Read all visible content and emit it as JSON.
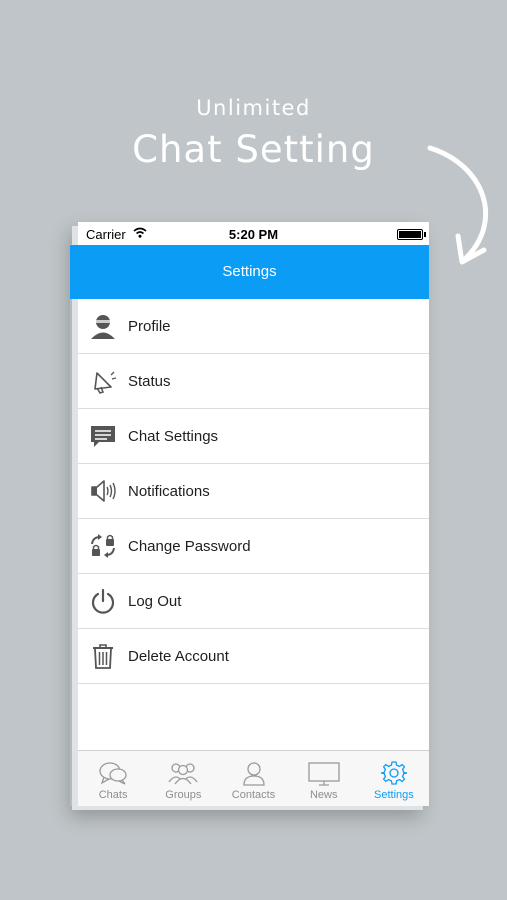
{
  "promo": {
    "subtitle": "Unlimited",
    "title": "Chat Setting"
  },
  "status_bar": {
    "carrier": "Carrier",
    "time": "5:20 PM"
  },
  "nav": {
    "title": "Settings",
    "color": "#0b9df5"
  },
  "menu": [
    {
      "label": "Profile",
      "icon": "profile-icon"
    },
    {
      "label": "Status",
      "icon": "megaphone-icon"
    },
    {
      "label": "Chat Settings",
      "icon": "chat-bubble-icon"
    },
    {
      "label": "Notifications",
      "icon": "speaker-icon"
    },
    {
      "label": "Change Password",
      "icon": "refresh-lock-icon"
    },
    {
      "label": "Log Out",
      "icon": "power-icon"
    },
    {
      "label": "Delete Account",
      "icon": "trash-icon"
    }
  ],
  "tabs": [
    {
      "label": "Chats",
      "icon": "chats-icon",
      "active": false
    },
    {
      "label": "Groups",
      "icon": "groups-icon",
      "active": false
    },
    {
      "label": "Contacts",
      "icon": "contact-icon",
      "active": false
    },
    {
      "label": "News",
      "icon": "tv-icon",
      "active": false
    },
    {
      "label": "Settings",
      "icon": "gear-icon",
      "active": true
    }
  ]
}
